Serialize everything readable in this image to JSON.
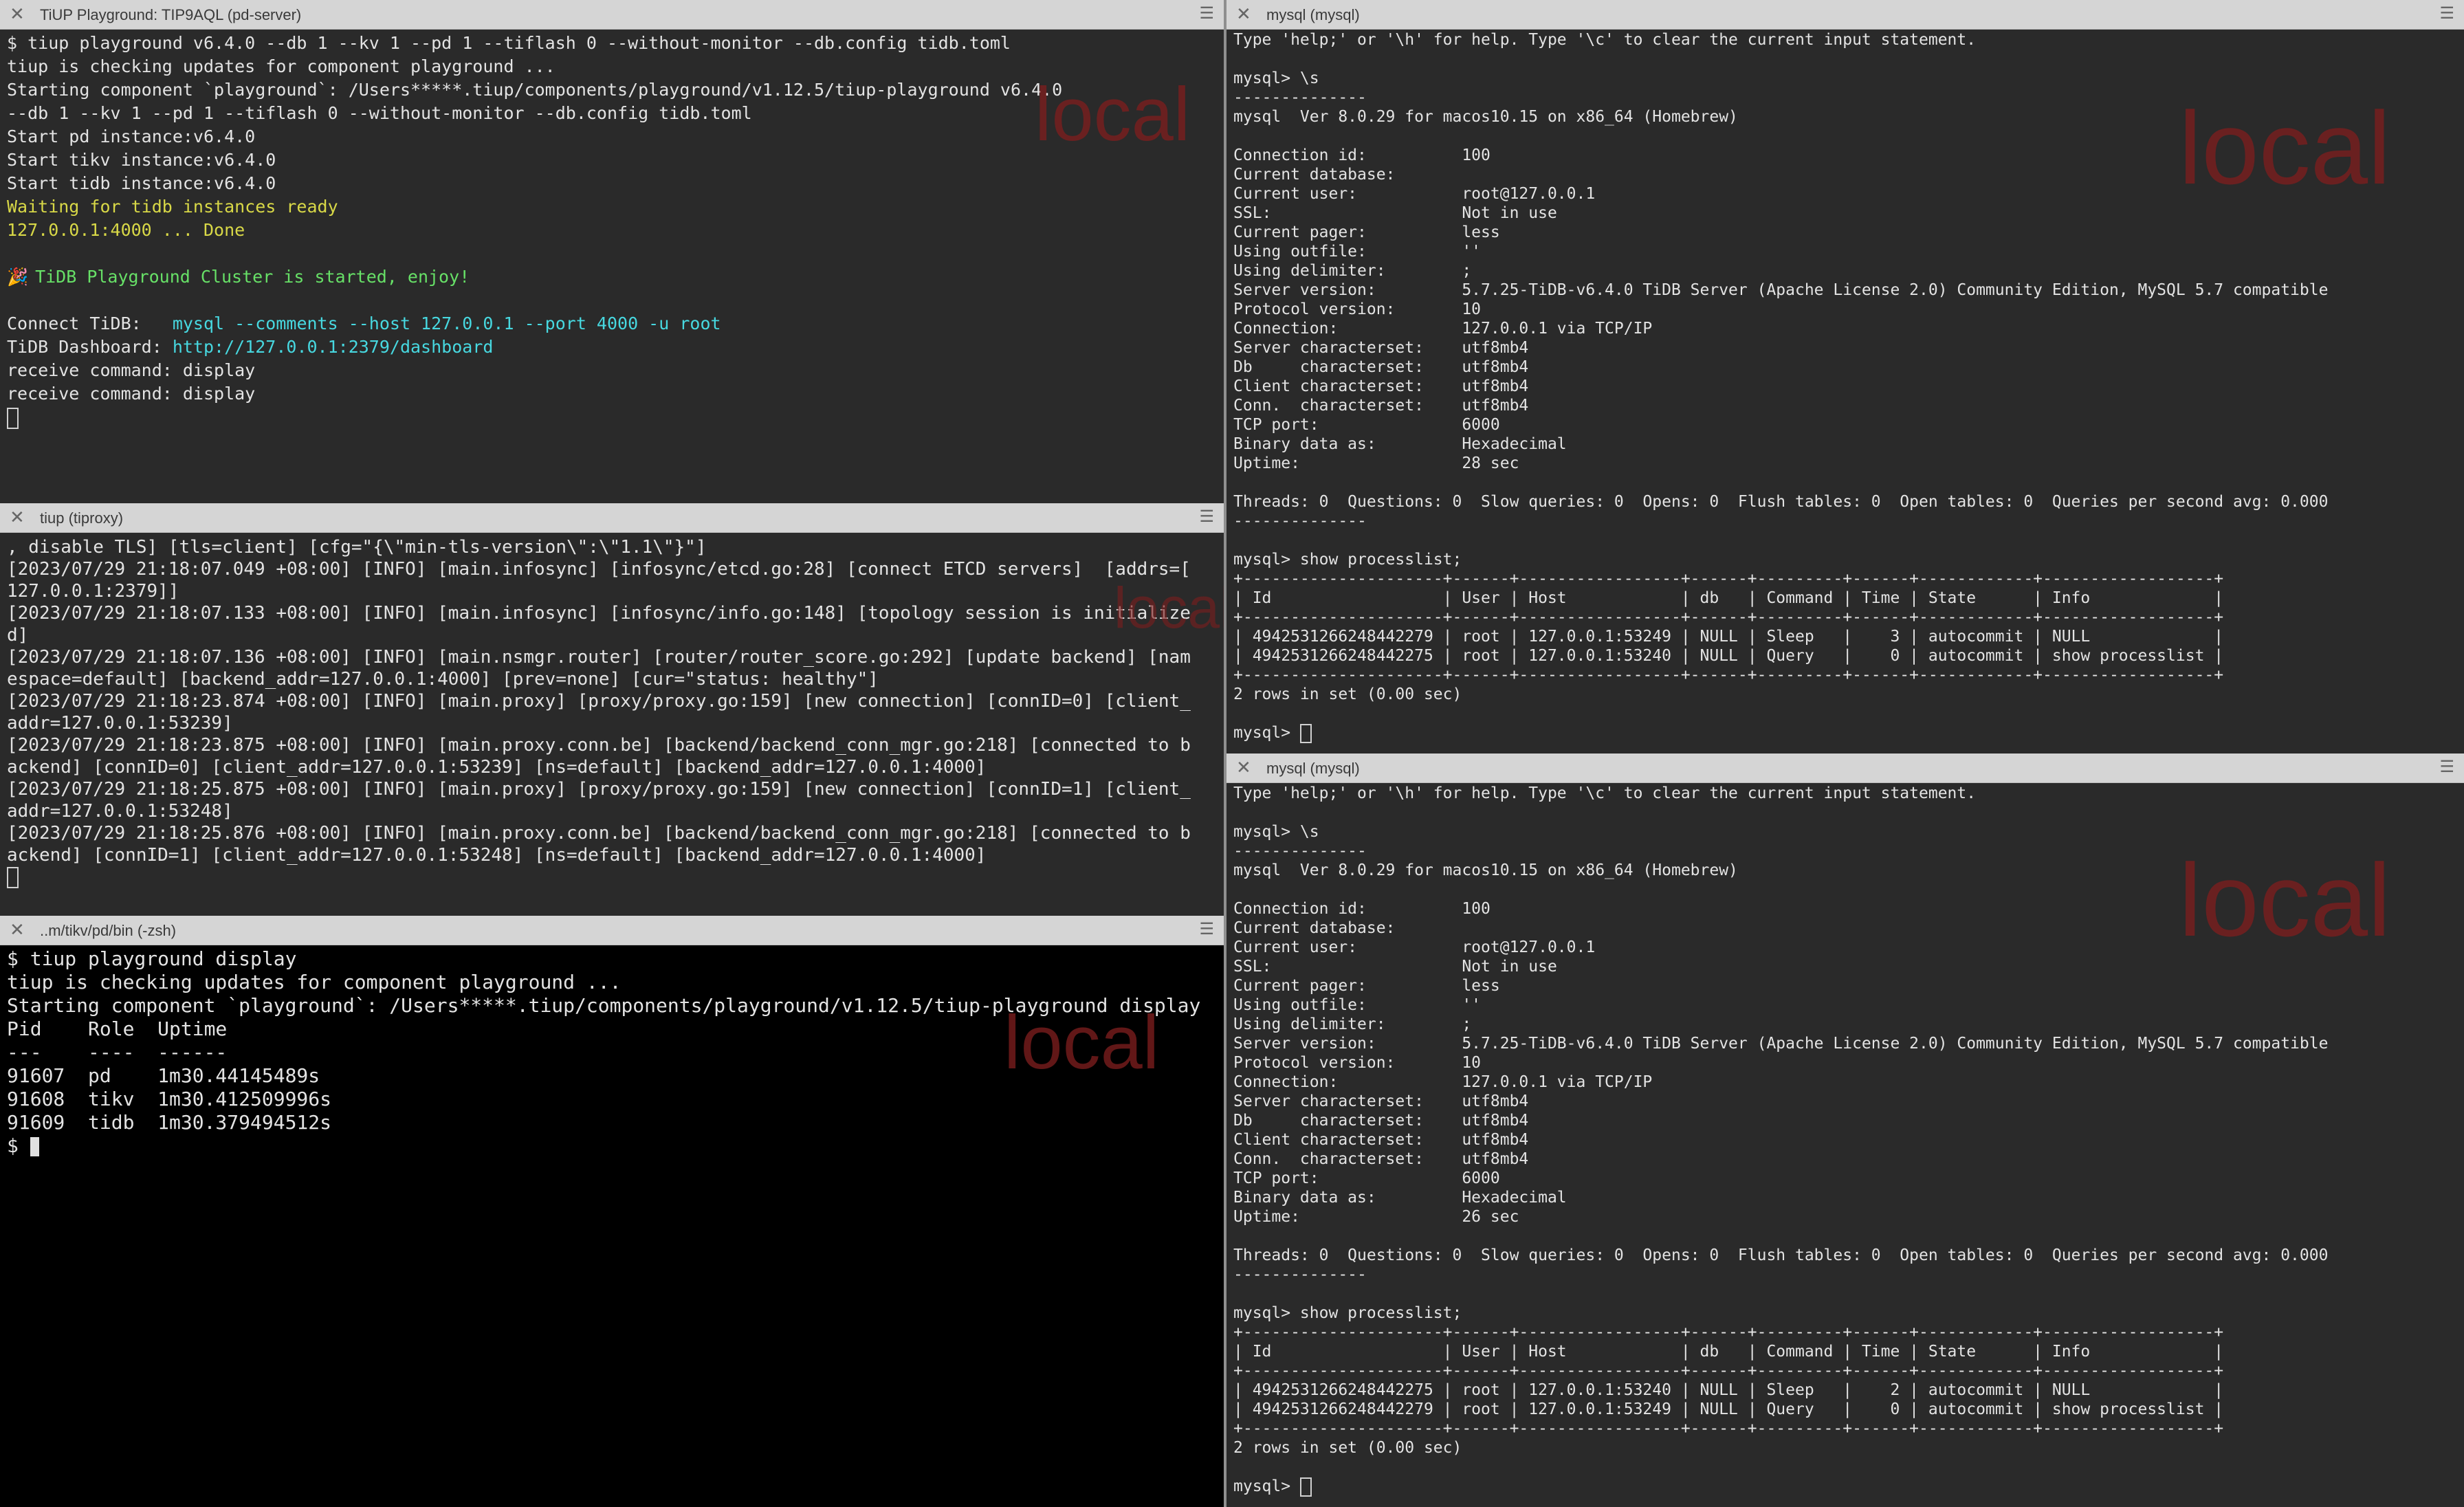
{
  "watermark": "local",
  "pane1": {
    "title": "TiUP Playground: TIP9AQL (pd-server)",
    "lines": [
      {
        "t": "$ tiup playground v6.4.0 --db 1 --kv 1 --pd 1 --tiflash 0 --without-monitor --db.config tidb.toml"
      },
      {
        "t": "tiup is checking updates for component playground ..."
      },
      {
        "t": "Starting component `playground`: /Users*****.tiup/components/playground/v1.12.5/tiup-playground v6.4.0"
      },
      {
        "t": "--db 1 --kv 1 --pd 1 --tiflash 0 --without-monitor --db.config tidb.toml"
      },
      {
        "t": "Start pd instance:v6.4.0"
      },
      {
        "t": "Start tikv instance:v6.4.0"
      },
      {
        "t": "Start tidb instance:v6.4.0"
      },
      {
        "t": "Waiting for tidb instances ready",
        "c": "yellow"
      },
      {
        "t": "127.0.0.1:4000 ... Done",
        "c": "yellow"
      },
      {
        "t": ""
      },
      {
        "t": "TiDB Playground Cluster is started, enjoy!",
        "c": "green",
        "icon": "🎉"
      },
      {
        "t": ""
      },
      {
        "t": "Connect TiDB:   ",
        "t2": "mysql --comments --host 127.0.0.1 --port 4000 -u root",
        "c2": "cyan"
      },
      {
        "t": "TiDB Dashboard: ",
        "t2": "http://127.0.0.1:2379/dashboard",
        "c2": "cyan"
      },
      {
        "t": "receive command: display"
      },
      {
        "t": "receive command: display"
      }
    ]
  },
  "pane2": {
    "title": "tiup (tiproxy)",
    "lines": [
      ", disable TLS] [tls=client] [cfg=\"{\\\"min-tls-version\\\":\\\"1.1\\\"}\"]",
      "[2023/07/29 21:18:07.049 +08:00] [INFO] [main.infosync] [infosync/etcd.go:28] [connect ETCD servers]  [addrs=[",
      "127.0.0.1:2379]]",
      "[2023/07/29 21:18:07.133 +08:00] [INFO] [main.infosync] [infosync/info.go:148] [topology session is initialize",
      "d]",
      "[2023/07/29 21:18:07.136 +08:00] [INFO] [main.nsmgr.router] [router/router_score.go:292] [update backend] [nam",
      "espace=default] [backend_addr=127.0.0.1:4000] [prev=none] [cur=\"status: healthy\"]",
      "[2023/07/29 21:18:23.874 +08:00] [INFO] [main.proxy] [proxy/proxy.go:159] [new connection] [connID=0] [client_",
      "addr=127.0.0.1:53239]",
      "[2023/07/29 21:18:23.875 +08:00] [INFO] [main.proxy.conn.be] [backend/backend_conn_mgr.go:218] [connected to b",
      "ackend] [connID=0] [client_addr=127.0.0.1:53239] [ns=default] [backend_addr=127.0.0.1:4000]",
      "[2023/07/29 21:18:25.875 +08:00] [INFO] [main.proxy] [proxy/proxy.go:159] [new connection] [connID=1] [client_",
      "addr=127.0.0.1:53248]",
      "[2023/07/29 21:18:25.876 +08:00] [INFO] [main.proxy.conn.be] [backend/backend_conn_mgr.go:218] [connected to b",
      "ackend] [connID=1] [client_addr=127.0.0.1:53248] [ns=default] [backend_addr=127.0.0.1:4000]"
    ]
  },
  "pane3": {
    "title": "..m/tikv/pd/bin (-zsh)",
    "lines": [
      "$ tiup playground display",
      "tiup is checking updates for component playground ...",
      "Starting component `playground`: /Users*****.tiup/components/playground/v1.12.5/tiup-playground display",
      "Pid    Role  Uptime",
      "---    ----  ------",
      "91607  pd    1m30.44145489s",
      "91608  tikv  1m30.412509996s",
      "91609  tidb  1m30.379494512s"
    ],
    "prompt": "$ "
  },
  "pane4": {
    "title": "mysql (mysql)",
    "lines": [
      "Type 'help;' or '\\h' for help. Type '\\c' to clear the current input statement.",
      "",
      "mysql> \\s",
      "--------------",
      "mysql  Ver 8.0.29 for macos10.15 on x86_64 (Homebrew)",
      "",
      "Connection id:          100",
      "Current database:",
      "Current user:           root@127.0.0.1",
      "SSL:                    Not in use",
      "Current pager:          less",
      "Using outfile:          ''",
      "Using delimiter:        ;",
      "Server version:         5.7.25-TiDB-v6.4.0 TiDB Server (Apache License 2.0) Community Edition, MySQL 5.7 compatible",
      "Protocol version:       10",
      "Connection:             127.0.0.1 via TCP/IP",
      "Server characterset:    utf8mb4",
      "Db     characterset:    utf8mb4",
      "Client characterset:    utf8mb4",
      "Conn.  characterset:    utf8mb4",
      "TCP port:               6000",
      "Binary data as:         Hexadecimal",
      "Uptime:                 28 sec",
      "",
      "Threads: 0  Questions: 0  Slow queries: 0  Opens: 0  Flush tables: 0  Open tables: 0  Queries per second avg: 0.000",
      "--------------",
      "",
      "mysql> show processlist;",
      "+---------------------+------+-----------------+------+---------+------+------------+------------------+",
      "| Id                  | User | Host            | db   | Command | Time | State      | Info             |",
      "+---------------------+------+-----------------+------+---------+------+------------+------------------+",
      "| 4942531266248442279 | root | 127.0.0.1:53249 | NULL | Sleep   |    3 | autocommit | NULL             |",
      "| 4942531266248442275 | root | 127.0.0.1:53240 | NULL | Query   |    0 | autocommit | show processlist |",
      "+---------------------+------+-----------------+------+---------+------+------------+------------------+",
      "2 rows in set (0.00 sec)",
      ""
    ],
    "prompt": "mysql> "
  },
  "pane5": {
    "title": "mysql (mysql)",
    "lines": [
      "Type 'help;' or '\\h' for help. Type '\\c' to clear the current input statement.",
      "",
      "mysql> \\s",
      "--------------",
      "mysql  Ver 8.0.29 for macos10.15 on x86_64 (Homebrew)",
      "",
      "Connection id:          100",
      "Current database:",
      "Current user:           root@127.0.0.1",
      "SSL:                    Not in use",
      "Current pager:          less",
      "Using outfile:          ''",
      "Using delimiter:        ;",
      "Server version:         5.7.25-TiDB-v6.4.0 TiDB Server (Apache License 2.0) Community Edition, MySQL 5.7 compatible",
      "Protocol version:       10",
      "Connection:             127.0.0.1 via TCP/IP",
      "Server characterset:    utf8mb4",
      "Db     characterset:    utf8mb4",
      "Client characterset:    utf8mb4",
      "Conn.  characterset:    utf8mb4",
      "TCP port:               6000",
      "Binary data as:         Hexadecimal",
      "Uptime:                 26 sec",
      "",
      "Threads: 0  Questions: 0  Slow queries: 0  Opens: 0  Flush tables: 0  Open tables: 0  Queries per second avg: 0.000",
      "--------------",
      "",
      "mysql> show processlist;",
      "+---------------------+------+-----------------+------+---------+------+------------+------------------+",
      "| Id                  | User | Host            | db   | Command | Time | State      | Info             |",
      "+---------------------+------+-----------------+------+---------+------+------------+------------------+",
      "| 4942531266248442275 | root | 127.0.0.1:53240 | NULL | Sleep   |    2 | autocommit | NULL             |",
      "| 4942531266248442279 | root | 127.0.0.1:53249 | NULL | Query   |    0 | autocommit | show processlist |",
      "+---------------------+------+-----------------+------+---------+------+------------+------------------+",
      "2 rows in set (0.00 sec)",
      ""
    ],
    "prompt": "mysql> "
  }
}
